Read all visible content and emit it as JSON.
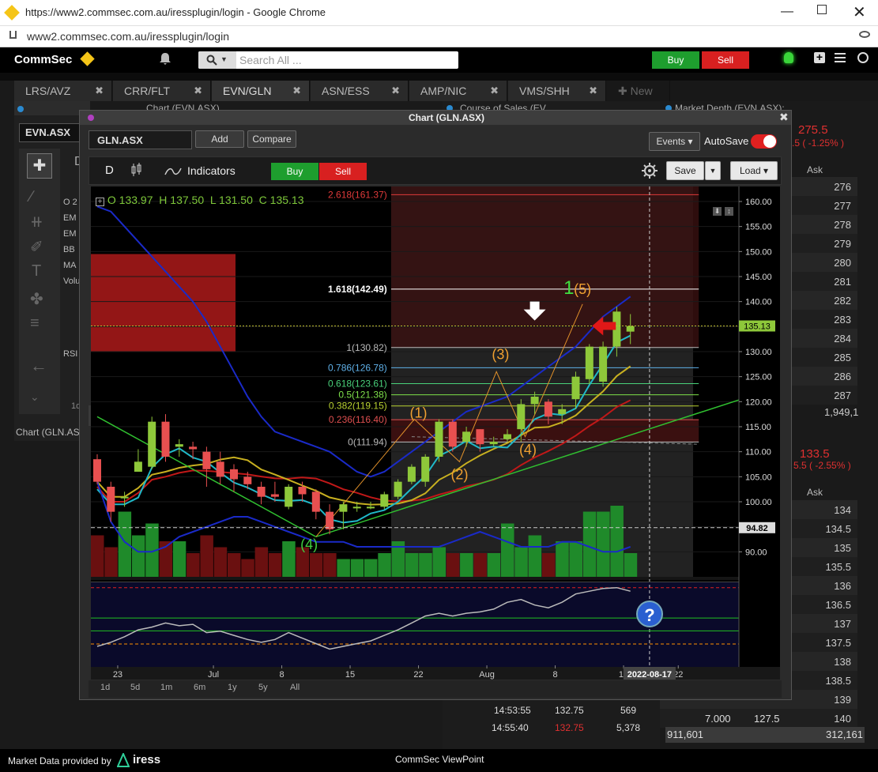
{
  "browser": {
    "title": "https://www2.commsec.com.au/iressplugin/login - Google Chrome",
    "url": "www2.commsec.com.au/iressplugin/login"
  },
  "app": {
    "brand": "CommSec",
    "search_placeholder": "Search All ...",
    "buy": "Buy",
    "sell": "Sell"
  },
  "tabs": [
    {
      "label": "LRS/AVZ"
    },
    {
      "label": "CRR/FLT"
    },
    {
      "label": "EVN/GLN"
    },
    {
      "label": "ASN/ESS"
    },
    {
      "label": "AMP/NIC"
    },
    {
      "label": "VMS/SHH"
    }
  ],
  "new_tab": "New",
  "panels": {
    "left_title": "Chart (EVN.ASX)",
    "left_symbol": "EVN.ASX",
    "left_chart_tab": "Chart (GLN.ASX)",
    "cos_title": "Course of Sales (EV...",
    "md_title": "Market Depth (EVN.ASX):..."
  },
  "left_sidebar_labels": [
    "O 2",
    "EM",
    "EM",
    "BB",
    "MA",
    "Volu",
    "RSI"
  ],
  "left_one_d": "1d",
  "chart": {
    "window_title": "Chart (GLN.ASX)",
    "symbol": "GLN.ASX",
    "add": "Add",
    "compare": "Compare",
    "events": "Events",
    "autosave": "AutoSave",
    "period": "D",
    "indicators": "Indicators",
    "buy": "Buy",
    "sell": "Sell",
    "save": "Save",
    "load": "Load",
    "ohlc": {
      "o": "O 133.97",
      "h": "H 137.50",
      "l": "L 131.50",
      "c": "C 135.13"
    },
    "timeframes": [
      "1d",
      "5d",
      "1m",
      "6m",
      "1y",
      "5y",
      "All"
    ]
  },
  "market_depth_top": {
    "price": "275.5",
    "change": ".5 ( -1.25% )",
    "ask_header": "Ask",
    "asks": [
      "276",
      "277",
      "278",
      "279",
      "280",
      "281",
      "282",
      "283",
      "284",
      "285",
      "286",
      "287"
    ],
    "total": "1,949,1"
  },
  "market_depth_bottom": {
    "price": "133.5",
    "change": "5.5 ( -2.55% )",
    "ask_header": "Ask",
    "asks": [
      "134",
      "134.5",
      "135",
      "135.5",
      "136",
      "136.5",
      "137",
      "137.5",
      "138",
      "138.5",
      "139",
      "140"
    ],
    "last_row": [
      "7.000",
      "127.5"
    ],
    "total_left": "911,601",
    "total_right": "312,161"
  },
  "course_of_sales": [
    {
      "time": "14:53:55",
      "price": "132.75",
      "vol": "569"
    },
    {
      "time": "14:55:40",
      "price": "132.75",
      "vol": "5,378"
    }
  ],
  "footer": {
    "provider": "Market Data provided by",
    "provider_brand": "iress",
    "app_name": "CommSec ViewPoint"
  },
  "chart_data": {
    "type": "candlestick",
    "symbol": "GLN.ASX",
    "ylim": [
      85,
      163
    ],
    "yticks": [
      90,
      95,
      100,
      105,
      110,
      115,
      120,
      125,
      130,
      135,
      140,
      145,
      150,
      155,
      160
    ],
    "xticks": [
      {
        "i": 1.5,
        "label": "23"
      },
      {
        "i": 8.5,
        "label": "Jul"
      },
      {
        "i": 13.5,
        "label": "8"
      },
      {
        "i": 18.5,
        "label": "15"
      },
      {
        "i": 23.5,
        "label": "22"
      },
      {
        "i": 28.5,
        "label": "Aug"
      },
      {
        "i": 33.5,
        "label": "8"
      },
      {
        "i": 38.5,
        "label": "15"
      },
      {
        "i": 42.5,
        "label": "22"
      }
    ],
    "current_price": "135.13",
    "date_marker": "2022-08-17",
    "ref_line": "94.82",
    "candles": [
      [
        108.5,
        104.0,
        109.5,
        103.5
      ],
      [
        103.0,
        98.0,
        104.0,
        96.0
      ],
      [
        101.0,
        101.0,
        102.0,
        99.0
      ],
      [
        106.0,
        108.0,
        110.5,
        106.0
      ],
      [
        107.0,
        116.0,
        117.0,
        106.5
      ],
      [
        116.0,
        109.0,
        117.5,
        108.0
      ],
      [
        111.0,
        111.5,
        112.5,
        109.0
      ],
      [
        111.0,
        110.5,
        112.0,
        108.5
      ],
      [
        110.0,
        106.5,
        111.0,
        103.0
      ],
      [
        108.0,
        105.0,
        110.0,
        103.5
      ],
      [
        106.5,
        104.5,
        107.5,
        102.0
      ],
      [
        105.0,
        103.5,
        106.0,
        102.5
      ],
      [
        103.0,
        101.0,
        104.0,
        99.5
      ],
      [
        101.5,
        101.0,
        104.0,
        100.0
      ],
      [
        99.0,
        103.0,
        103.5,
        98.5
      ],
      [
        103.0,
        101.5,
        104.0,
        100.0
      ],
      [
        102.0,
        98.0,
        102.5,
        96.5
      ],
      [
        98.0,
        94.5,
        99.5,
        93.5
      ],
      [
        98.0,
        99.5,
        100.0,
        94.5
      ],
      [
        99.0,
        99.0,
        100.0,
        98.0
      ],
      [
        99.0,
        99.0,
        100.0,
        98.5
      ],
      [
        99.0,
        101.5,
        102.0,
        98.5
      ],
      [
        101.0,
        104.0,
        104.5,
        100.5
      ],
      [
        104.0,
        107.0,
        107.5,
        103.5
      ],
      [
        104.0,
        109.0,
        109.5,
        103.0
      ],
      [
        109.0,
        116.0,
        116.5,
        108.0
      ],
      [
        116.0,
        111.0,
        116.5,
        110.0
      ],
      [
        112.0,
        114.0,
        115.0,
        111.0
      ],
      [
        114.5,
        111.5,
        114.5,
        110.0
      ],
      [
        111.5,
        112.0,
        113.0,
        111.0
      ],
      [
        112.5,
        113.5,
        114.5,
        112.0
      ],
      [
        114.5,
        119.5,
        120.5,
        112.0
      ],
      [
        119.5,
        121.0,
        122.0,
        117.5
      ],
      [
        120.0,
        117.0,
        120.5,
        115.5
      ],
      [
        117.5,
        118.5,
        119.5,
        115.5
      ],
      [
        120.5,
        125.0,
        126.0,
        118.5
      ],
      [
        124.5,
        131.0,
        131.5,
        123.5
      ],
      [
        124.0,
        131.0,
        132.0,
        123.0
      ],
      [
        131.0,
        138.0,
        139.0,
        129.0
      ],
      [
        134.0,
        135.1,
        137.5,
        131.5
      ]
    ],
    "volume": [
      0.35,
      0.25,
      0.55,
      0.35,
      0.45,
      0.3,
      0.3,
      0.2,
      0.35,
      0.25,
      0.2,
      0.15,
      0.25,
      0.2,
      0.3,
      0.25,
      0.2,
      0.2,
      0.15,
      0.15,
      0.15,
      0.2,
      0.3,
      0.2,
      0.2,
      0.25,
      0.2,
      0.2,
      0.2,
      0.2,
      0.45,
      0.25,
      0.35,
      0.2,
      0.3,
      0.3,
      0.55,
      0.55,
      0.6,
      0.2
    ],
    "rsi": {
      "values": [
        28,
        31,
        35,
        40,
        42,
        45,
        43,
        44,
        38,
        39,
        36,
        33,
        31,
        33,
        38,
        34,
        30,
        26,
        28,
        30,
        32,
        36,
        40,
        45,
        50,
        52,
        50,
        52,
        53,
        55,
        60,
        62,
        58,
        56,
        60,
        66,
        68,
        70,
        70.6,
        68
      ]
    },
    "rsi_levels": [
      {
        "label": "70.5897",
        "value": 70.5897,
        "color": "#e02020"
      },
      {
        "label": "48.5750",
        "value": 48.575,
        "color": "#22c022"
      },
      {
        "label": "39.2932",
        "value": 39.2932,
        "color": "#22c022"
      },
      {
        "label": "29.7126",
        "value": 29.7126,
        "color": "#ff9000"
      }
    ],
    "rsi_tick": "60.0000",
    "fib_levels": [
      {
        "label": "2.618(161.37)",
        "value": 161.37,
        "color": "#e03a3a"
      },
      {
        "label": "1.618(142.49)",
        "value": 142.49,
        "color": "#ffffff"
      },
      {
        "label": "1(130.82)",
        "value": 130.82,
        "color": "#bbbbbb"
      },
      {
        "label": "0.786(126.78)",
        "value": 126.78,
        "color": "#5fb0e8"
      },
      {
        "label": "0.618(123.61)",
        "value": 123.61,
        "color": "#49d17a"
      },
      {
        "label": "0.5(121.38)",
        "value": 121.38,
        "color": "#7ee04a"
      },
      {
        "label": "0.382(119.15)",
        "value": 119.15,
        "color": "#b8d030"
      },
      {
        "label": "0.236(116.40)",
        "value": 116.4,
        "color": "#e05050"
      },
      {
        "label": "0(111.94)",
        "value": 111.94,
        "color": "#bbbbbb"
      }
    ],
    "wave_labels": [
      {
        "label": "(1)",
        "i": 23.5,
        "v": 116.8,
        "color": "#f0a030"
      },
      {
        "label": "(2)",
        "i": 26.5,
        "v": 104.5,
        "color": "#f0a030"
      },
      {
        "label": "(3)",
        "i": 29.5,
        "v": 128.5,
        "color": "#f0a030"
      },
      {
        "label": "(4)",
        "i": 31.5,
        "v": 109.5,
        "color": "#f0a030"
      },
      {
        "label": "(5)",
        "i": 35.5,
        "v": 141.5,
        "color": "#f0a030"
      },
      {
        "label": "(4)",
        "i": 15.5,
        "v": 90.5,
        "color": "#40d040"
      },
      {
        "label": "1",
        "i": 34.5,
        "v": 141.5,
        "color": "#40e040"
      }
    ]
  }
}
